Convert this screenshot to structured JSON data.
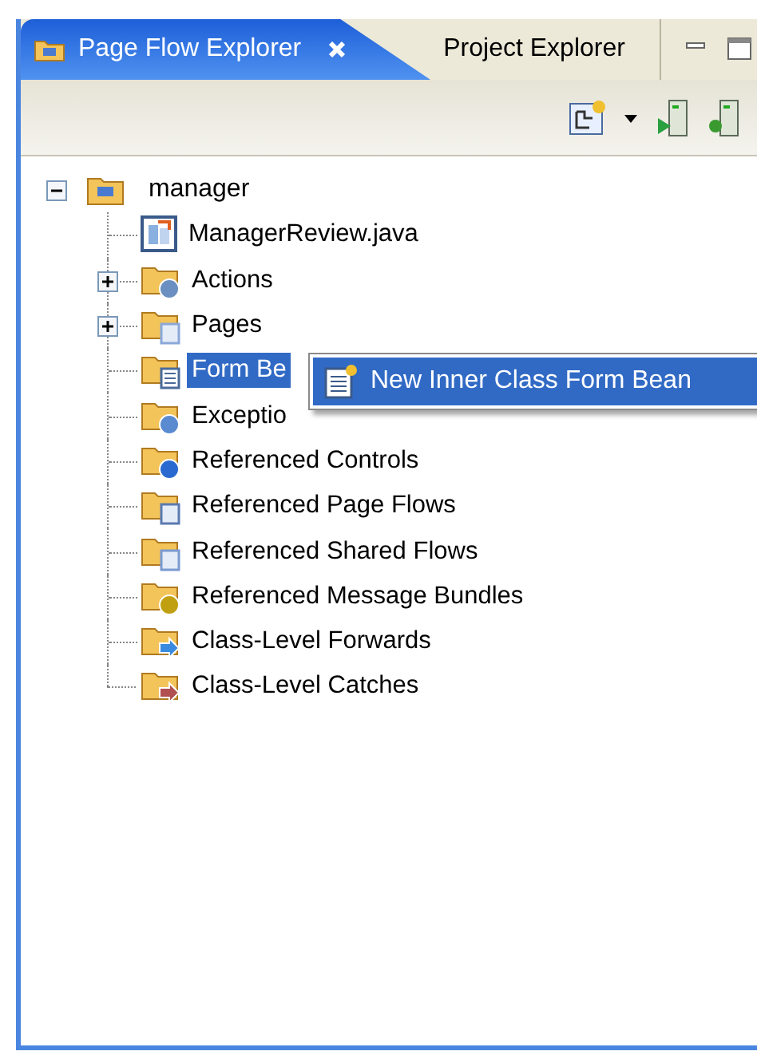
{
  "tabs": [
    {
      "label": "Page Flow Explorer",
      "selected": true,
      "closable": true
    },
    {
      "label": "Project Explorer",
      "selected": false,
      "closable": false
    }
  ],
  "tree": {
    "label": "manager",
    "expanded": true,
    "children": [
      {
        "label": "ManagerReview.java",
        "kind": "java",
        "selected": false
      },
      {
        "label": "Actions",
        "kind": "actions",
        "expanded": false,
        "selected": false
      },
      {
        "label": "Pages",
        "kind": "pages",
        "expanded": false,
        "selected": false
      },
      {
        "label": "Form Be",
        "kind": "formbeans",
        "selected": true
      },
      {
        "label": "Exceptio",
        "kind": "exceptions",
        "selected": false
      },
      {
        "label": "Referenced Controls",
        "kind": "controls",
        "selected": false
      },
      {
        "label": "Referenced Page Flows",
        "kind": "pageflows",
        "selected": false
      },
      {
        "label": "Referenced Shared Flows",
        "kind": "sharedflows",
        "selected": false
      },
      {
        "label": "Referenced Message Bundles",
        "kind": "bundles",
        "selected": false
      },
      {
        "label": "Class-Level Forwards",
        "kind": "forwards",
        "selected": false
      },
      {
        "label": "Class-Level Catches",
        "kind": "catches",
        "selected": false
      }
    ]
  },
  "context_menu": {
    "items": [
      {
        "label": "New Inner Class Form Bean",
        "selected": true
      }
    ]
  }
}
